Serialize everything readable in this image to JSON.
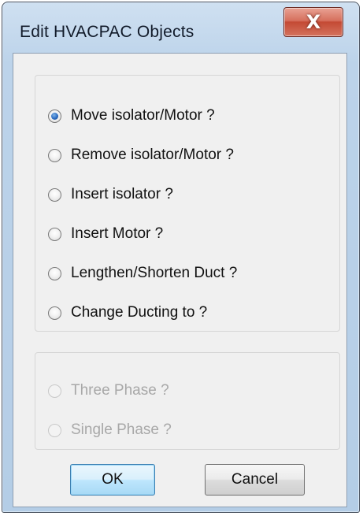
{
  "window": {
    "title": "Edit HVACPAC Objects",
    "close_glyph": "X"
  },
  "options": [
    {
      "label": "Move isolator/Motor ?",
      "checked": true
    },
    {
      "label": "Remove isolator/Motor ?",
      "checked": false
    },
    {
      "label": "Insert isolator ?",
      "checked": false
    },
    {
      "label": "Insert Motor ?",
      "checked": false
    },
    {
      "label": "Lengthen/Shorten Duct ?",
      "checked": false
    },
    {
      "label": "Change Ducting to ?",
      "checked": false
    }
  ],
  "phase_options": [
    {
      "label": "Three Phase ?",
      "checked": false,
      "enabled": false
    },
    {
      "label": "Single Phase ?",
      "checked": false,
      "enabled": false
    }
  ],
  "buttons": {
    "ok_label": "OK",
    "cancel_label": "Cancel"
  },
  "colors": {
    "title_bar": "#bcd3ea",
    "close_button": "#c44a34",
    "selected_radio": "#2b6cc2",
    "default_button_border": "#3c7fb1",
    "disabled_text": "#a8a8a8"
  }
}
